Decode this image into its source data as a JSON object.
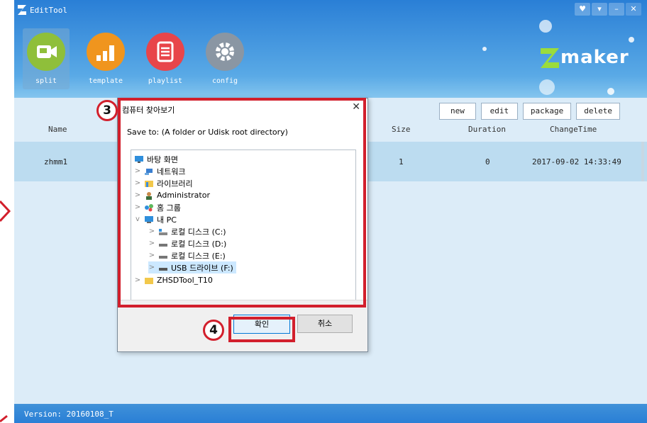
{
  "window": {
    "title": "EditTool",
    "version": "Version: 20160108_T",
    "brand": "maker"
  },
  "window_buttons": [
    "♥",
    "▾",
    "–",
    "✕"
  ],
  "toolbar": [
    {
      "label": "split",
      "icon": "video-camera-icon",
      "color": "#8fbf3a",
      "active": true
    },
    {
      "label": "template",
      "icon": "bar-chart-icon",
      "color": "#f0951e",
      "active": false
    },
    {
      "label": "playlist",
      "icon": "document-list-icon",
      "color": "#e8454a",
      "active": false
    },
    {
      "label": "config",
      "icon": "gear-icon",
      "color": "#8a96a3",
      "active": false
    }
  ],
  "actions": {
    "new": "new",
    "edit": "edit",
    "package": "package",
    "delete": "delete"
  },
  "table": {
    "headers": {
      "name": "Name",
      "size": "Size",
      "duration": "Duration",
      "changetime": "ChangeTime"
    },
    "rows": [
      {
        "name": "zhmm1",
        "size": "1",
        "duration": "0",
        "changetime": "2017-09-02 14:33:49"
      }
    ]
  },
  "dialog": {
    "title": "컴퓨터 찾아보기",
    "close": "✕",
    "prompt": "Save to: (A folder or Udisk root directory)",
    "tree": [
      {
        "label": "바탕 화면",
        "icon": "desktop-icon",
        "expander": ""
      },
      {
        "label": "네트워크",
        "icon": "network-icon",
        "expander": ">"
      },
      {
        "label": "라이브러리",
        "icon": "library-icon",
        "expander": ">"
      },
      {
        "label": "Administrator",
        "icon": "user-icon",
        "expander": ">"
      },
      {
        "label": "홈 그룹",
        "icon": "homegroup-icon",
        "expander": ">"
      },
      {
        "label": "내 PC",
        "icon": "pc-icon",
        "expander": "v"
      },
      {
        "label": "로컬 디스크 (C:)",
        "icon": "system-drive-icon",
        "expander": ">"
      },
      {
        "label": "로컬 디스크 (D:)",
        "icon": "drive-icon",
        "expander": ">"
      },
      {
        "label": "로컬 디스크 (E:)",
        "icon": "drive-icon",
        "expander": ">"
      },
      {
        "label": "USB 드라이브 (F:)",
        "icon": "usb-drive-icon",
        "expander": ">",
        "selected": true
      },
      {
        "label": "ZHSDTool_T10",
        "icon": "folder-icon",
        "expander": ">"
      }
    ],
    "ok": "확인",
    "cancel": "취소"
  },
  "annotations": {
    "step3": "3",
    "step4": "4",
    "color": "#d21f2c"
  }
}
